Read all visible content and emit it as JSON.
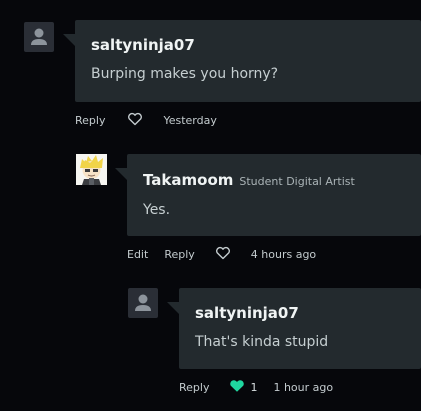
{
  "comments": [
    {
      "username": "saltyninja07",
      "title": "",
      "message": "Burping makes you horny?",
      "actions": {
        "edit": "",
        "reply": "Reply",
        "time": "Yesterday",
        "like_count": ""
      },
      "avatar_icon": "default-user-icon"
    },
    {
      "username": "Takamoom",
      "title": "Student Digital Artist",
      "message": "Yes.",
      "actions": {
        "edit": "Edit",
        "reply": "Reply",
        "time": "4 hours ago",
        "like_count": ""
      },
      "avatar_icon": "anime-character-avatar"
    },
    {
      "username": "saltyninja07",
      "title": "",
      "message": "That's kinda stupid",
      "actions": {
        "edit": "",
        "reply": "Reply",
        "time": "1 hour ago",
        "like_count": "1"
      },
      "avatar_icon": "default-user-icon"
    }
  ],
  "colors": {
    "background": "#06070b",
    "bubble": "#232a2e",
    "liked_heart": "#1fd7a0",
    "text_muted": "#c6cfd1"
  }
}
